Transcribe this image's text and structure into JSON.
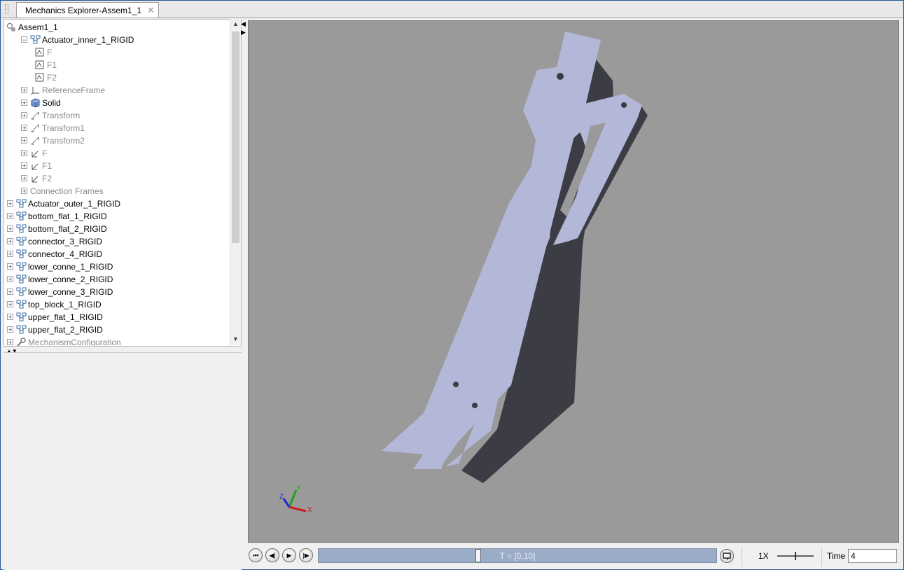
{
  "window": {
    "tab_title": "Mechanics Explorer-Assem1_1",
    "accent": "#2b5797"
  },
  "tree": {
    "items": [
      {
        "label": "Assem1_1",
        "icon": "assembly-icon",
        "dim": false
      },
      {
        "label": "Actuator_inner_1_RIGID",
        "icon": "subsystem-icon",
        "dim": false
      },
      {
        "label": "F",
        "icon": "port-icon",
        "dim": true
      },
      {
        "label": "F1",
        "icon": "port-icon",
        "dim": true
      },
      {
        "label": "F2",
        "icon": "port-icon",
        "dim": true
      },
      {
        "label": "ReferenceFrame",
        "icon": "reference-frame-icon",
        "dim": true
      },
      {
        "label": "Solid",
        "icon": "solid-cube-icon",
        "dim": false
      },
      {
        "label": "Transform",
        "icon": "transform-icon",
        "dim": true
      },
      {
        "label": "Transform1",
        "icon": "transform-icon",
        "dim": true
      },
      {
        "label": "Transform2",
        "icon": "transform-icon",
        "dim": true
      },
      {
        "label": "F",
        "icon": "frame-icon",
        "dim": true
      },
      {
        "label": "F1",
        "icon": "frame-icon",
        "dim": true
      },
      {
        "label": "F2",
        "icon": "frame-icon",
        "dim": true
      },
      {
        "label": "Connection Frames",
        "icon": "",
        "dim": true
      },
      {
        "label": "Actuator_outer_1_RIGID",
        "icon": "subsystem-icon",
        "dim": false
      },
      {
        "label": "bottom_flat_1_RIGID",
        "icon": "subsystem-icon",
        "dim": false
      },
      {
        "label": "bottom_flat_2_RIGID",
        "icon": "subsystem-icon",
        "dim": false
      },
      {
        "label": "connector_3_RIGID",
        "icon": "subsystem-icon",
        "dim": false
      },
      {
        "label": "connector_4_RIGID",
        "icon": "subsystem-icon",
        "dim": false
      },
      {
        "label": "lower_conne_1_RIGID",
        "icon": "subsystem-icon",
        "dim": false
      },
      {
        "label": "lower_conne_2_RIGID",
        "icon": "subsystem-icon",
        "dim": false
      },
      {
        "label": "lower_conne_3_RIGID",
        "icon": "subsystem-icon",
        "dim": false
      },
      {
        "label": "top_block_1_RIGID",
        "icon": "subsystem-icon",
        "dim": false
      },
      {
        "label": "upper_flat_1_RIGID",
        "icon": "subsystem-icon",
        "dim": false
      },
      {
        "label": "upper_flat_2_RIGID",
        "icon": "subsystem-icon",
        "dim": false
      },
      {
        "label": "MechanismConfiguration",
        "icon": "wrench-icon",
        "dim": true
      }
    ]
  },
  "viewport": {
    "background": "#9a9a9a",
    "part_color": "#b3b8d8",
    "triad": {
      "x": "X",
      "y": "Y",
      "z": "Z"
    }
  },
  "playback": {
    "time_range_label": "T = [0,10]",
    "progress_fraction": 0.4,
    "speed_label": "1X",
    "time_label": "Time",
    "time_value": "4"
  }
}
